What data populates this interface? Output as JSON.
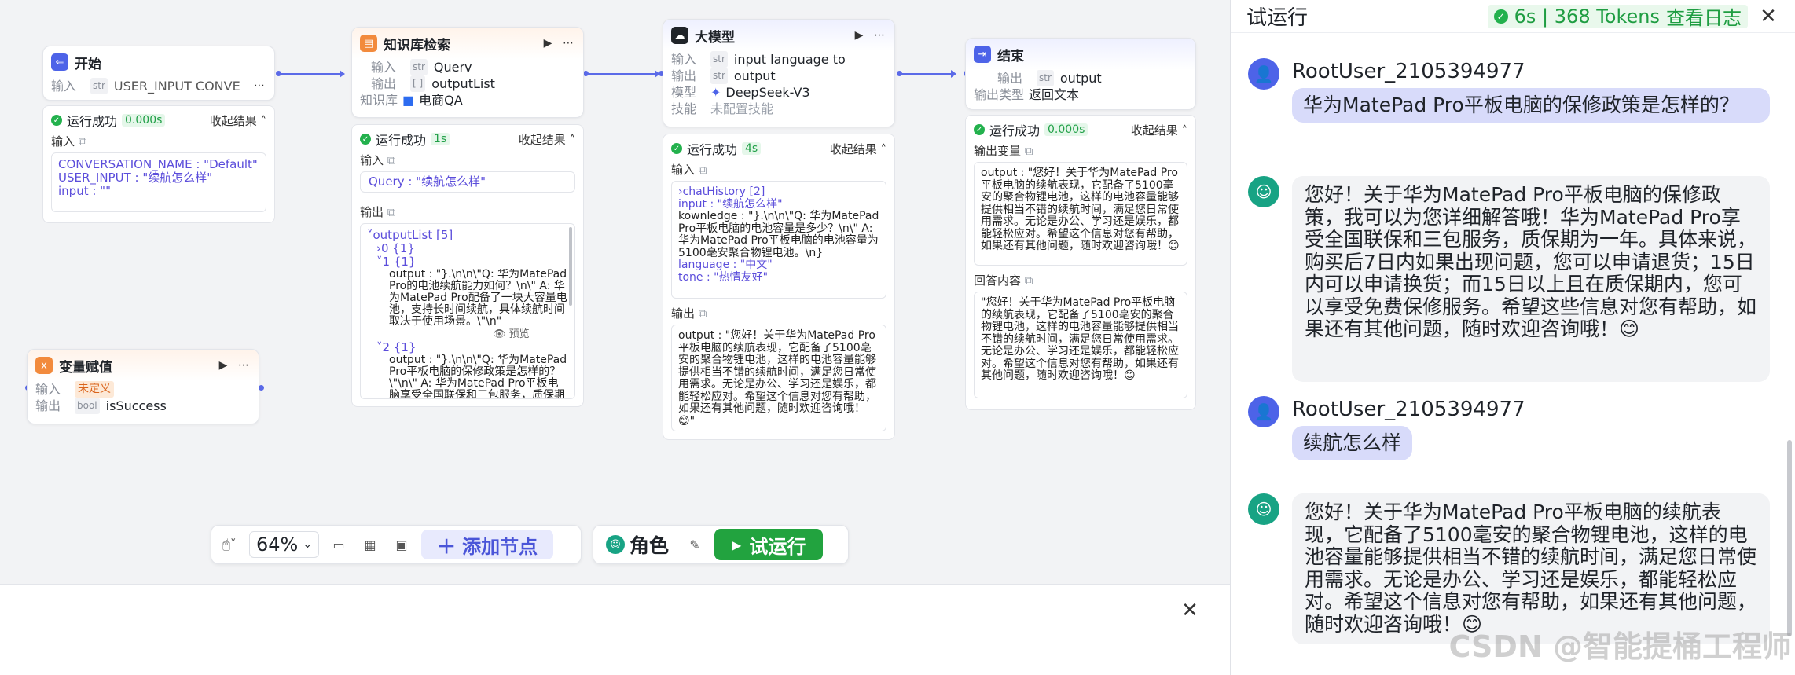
{
  "nodes": {
    "start": {
      "title": "开始",
      "input_label": "输入",
      "fields": "USER_INPUT  CONVE"
    },
    "kb": {
      "title": "知识库检索",
      "input_label": "输入",
      "input_val": "Querv",
      "output_label": "输出",
      "output_val": "outputList",
      "kb_label": "知识库",
      "kb_val": "电商QA"
    },
    "llm": {
      "title": "大模型",
      "input_label": "输入",
      "input_val": "input  language  to",
      "output_label": "输出",
      "output_val": "output",
      "model_label": "模型",
      "model_val": "DeepSeek-V3",
      "skill_label": "技能",
      "skill_val": "未配置技能"
    },
    "end": {
      "title": "结束",
      "output_label": "输出",
      "output_val": "output",
      "type_label": "输出类型",
      "type_val": "返回文本"
    },
    "assign": {
      "title": "变量赋值",
      "input_label": "输入",
      "input_val": "未定义",
      "output_label": "输出",
      "output_val": "isSuccess"
    }
  },
  "results": {
    "status": "运行成功",
    "collapse": "收起结果",
    "input_label": "输入",
    "output_label": "输出",
    "output_var_label": "输出变量",
    "answer_label": "回答内容",
    "start": {
      "time": "0.000s",
      "lines": [
        "CONVERSATION_NAME : \"Default\"",
        "USER_INPUT : \"续航怎么样\"",
        "input : \"\""
      ]
    },
    "kb": {
      "time": "1s",
      "query": "Query : \"续航怎么样\"",
      "list_head": "outputList [5]",
      "items": [
        "0 {1}",
        "1 {1}",
        "output : \"}.\\n\\n\\\"Q: 华为MatePad Pro的电池续航能力如何？\\n\\\" A: 华为MatePad Pro配备了一块大容量电池，支持长时间续航，具体续航时间取决于使用场景。\\\"\\n\"",
        "预览",
        "2 {1}",
        "output : \"}.\\n\\n\\\"Q: 华为MatePad Pro平板电脑的保修政策是怎样的？\\\"\\n\\\" A: 华为MatePad Pro平板电脑享受全国联保和三包服务，质保期为一"
      ]
    },
    "llm": {
      "time": "4s",
      "in_lines": [
        "chatHistory [2]",
        "input : \"续航怎么样\"",
        "kownledge : \"}.\\n\\n\\\"Q: 华为MatePad Pro平板电脑的电池容量是多少？\\n\\\" A: 华为MatePad Pro平板电脑的电池容量为5100毫安聚合物锂电池。\\n}",
        "language : \"中文\"",
        "tone : \"热情友好\""
      ],
      "out_text": "output : \"您好！关于华为MatePad Pro平板电脑的续航表现，它配备了5100毫安的聚合物锂电池，这样的电池容量能够提供相当不错的续航时间，满足您日常使用需求。无论是办公、学习还是娱乐，都能轻松应对。希望这个信息对您有帮助，如果还有其他问题，随时欢迎咨询哦！😊\""
    },
    "end": {
      "time": "0.000s",
      "out_var": "output : \"您好！关于华为MatePad Pro平板电脑的续航表现，它配备了5100毫安的聚合物锂电池，这样的电池容量能够提供相当不错的续航时间，满足您日常使用需求。无论是办公、学习还是娱乐，都能轻松应对。希望这个信息对您有帮助，如果还有其他问题，随时欢迎咨询哦！😊",
      "answer": "\"您好！关于华为MatePad Pro平板电脑的续航表现，它配备了5100毫安的聚合物锂电池，这样的电池容量能够提供相当不错的续航时间，满足您日常使用需求。无论是办公、学习还是娱乐，都能轻松应对。希望这个信息对您有帮助，如果还有其他问题，随时欢迎咨询哦！😊"
    }
  },
  "toolbar": {
    "zoom": "64%",
    "add_node": "添加节点",
    "role": "角色",
    "run": "试运行"
  },
  "side": {
    "title": "试运行",
    "stat": "6s | 368 Tokens",
    "log_link": "查看日志",
    "messages": [
      {
        "user": "RootUser_2105394977",
        "text": "华为MatePad Pro平板电脑的保修政策是怎样的？"
      },
      {
        "bot": "您好！关于华为MatePad Pro平板电脑的保修政策，我可以为您详细解答哦！华为MatePad Pro享受全国联保和三包服务，质保期为一年。具体来说，购买后7日内如果出现问题，您可以申请退货；15日内可以申请换货；而15日以上且在质保期内，您可以享受免费保修服务。希望这些信息对您有帮助，如果还有其他问题，随时欢迎咨询哦！😊"
      },
      {
        "user": "RootUser_2105394977",
        "text": "续航怎么样"
      },
      {
        "bot": "您好！关于华为MatePad Pro平板电脑的续航表现，它配备了5100毫安的聚合物锂电池，这样的电池容量能够提供相当不错的续航时间，满足您日常使用需求。无论是办公、学习还是娱乐，都能轻松应对。希望这个信息对您有帮助，如果还有其他问题，随时欢迎咨询哦！😊"
      }
    ],
    "watermark": "CSDN @智能提桶工程师"
  },
  "colors": {
    "accent": "#5b6ae8",
    "success": "#23b14d",
    "user_bubble": "#d8dbfa",
    "bot_bubble": "#f2f3f5"
  }
}
